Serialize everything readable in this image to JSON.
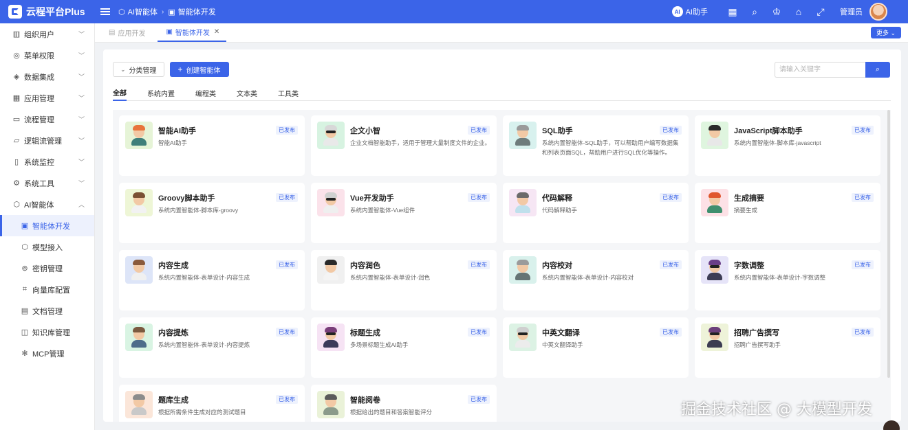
{
  "brand": {
    "title": "云程平台Plus"
  },
  "breadcrumb": [
    {
      "icon": "ai-cube-icon",
      "label": "AI智能体"
    },
    {
      "icon": "agent-dev-icon",
      "label": "智能体开发"
    }
  ],
  "header": {
    "ai_assistant": "AI助手",
    "ai_badge": "AI",
    "admin": "管理员"
  },
  "sidebar": {
    "items": [
      {
        "label": "组织用户",
        "icon": "org-icon"
      },
      {
        "label": "菜单权限",
        "icon": "menu-perm-icon"
      },
      {
        "label": "数据集成",
        "icon": "data-integration-icon"
      },
      {
        "label": "应用管理",
        "icon": "app-grid-icon"
      },
      {
        "label": "流程管理",
        "icon": "process-icon"
      },
      {
        "label": "逻辑流管理",
        "icon": "logic-flow-icon"
      },
      {
        "label": "系统监控",
        "icon": "monitor-icon"
      },
      {
        "label": "系统工具",
        "icon": "tool-gear-icon"
      },
      {
        "label": "AI智能体",
        "icon": "ai-cube-icon"
      }
    ],
    "sub_items": [
      {
        "label": "智能体开发",
        "icon": "agent-dev-icon",
        "active": true
      },
      {
        "label": "模型接入",
        "icon": "model-cube-icon"
      },
      {
        "label": "密钥管理",
        "icon": "key-icon"
      },
      {
        "label": "向量库配置",
        "icon": "vector-crop-icon"
      },
      {
        "label": "文档管理",
        "icon": "document-icon"
      },
      {
        "label": "知识库管理",
        "icon": "book-icon"
      },
      {
        "label": "MCP管理",
        "icon": "mcp-gear-icon"
      }
    ]
  },
  "tabs": [
    {
      "label": "应用开发",
      "active": false
    },
    {
      "label": "智能体开发",
      "active": true
    }
  ],
  "more_label": "更多",
  "toolbar": {
    "category_btn": "分类管理",
    "create_btn": "创建智能体"
  },
  "search": {
    "placeholder": "请输入关键字"
  },
  "categories": [
    "全部",
    "系统内置",
    "编程类",
    "文本类",
    "工具类"
  ],
  "status_label": "已发布",
  "agents": [
    {
      "title": "智能AI助手",
      "desc": "智能AI助手",
      "bg": "#e6f4d7",
      "hair": "#e8743b",
      "shirt": "#3f7f7a",
      "glasses": false
    },
    {
      "title": "企文小智",
      "desc": "企业文档智能助手，适用于管理大量制度文件的企业。",
      "bg": "#d7f3e1",
      "hair": "#d8d8d8",
      "shirt": "#e9e9e9",
      "glasses": true
    },
    {
      "title": "SQL助手",
      "desc": "系统内置智能体-SQL助手，可以帮助用户编写数据集和列表页面SQL，帮助用户进行SQL优化等操作。",
      "bg": "#d8f1ee",
      "hair": "#9a9a9a",
      "shirt": "#6e7c7c",
      "glasses": false
    },
    {
      "title": "JavaScript脚本助手",
      "desc": "系统内置智能体-脚本库-javascript",
      "bg": "#dff5df",
      "hair": "#2b2b2b",
      "shirt": "#e8e8e8",
      "glasses": false
    },
    {
      "title": "Groovy脚本助手",
      "desc": "系统内置智能体-脚本库-groovy",
      "bg": "#eef6d6",
      "hair": "#7a5034",
      "shirt": "#f2f2f2",
      "glasses": false
    },
    {
      "title": "Vue开发助手",
      "desc": "系统内置智能体-Vue组件",
      "bg": "#fbe2ea",
      "hair": "#d0d0d0",
      "shirt": "#efefef",
      "glasses": true
    },
    {
      "title": "代码解释",
      "desc": "代码解释助手",
      "bg": "#f6e6f4",
      "hair": "#6a6a6a",
      "shirt": "#bfe0ec",
      "glasses": false
    },
    {
      "title": "生成摘要",
      "desc": "摘要生成",
      "bg": "#fde1e6",
      "hair": "#e0572e",
      "shirt": "#3f8f6e",
      "glasses": false
    },
    {
      "title": "内容生成",
      "desc": "系统内置智能体-表单设计-内容生成",
      "bg": "#dde5f8",
      "hair": "#8a5a3c",
      "shirt": "#f0f0f0",
      "glasses": false
    },
    {
      "title": "内容润色",
      "desc": "系统内置智能体-表单设计-润色",
      "bg": "#f0f0f0",
      "hair": "#2a2a2a",
      "shirt": "#f4f4f4",
      "glasses": false
    },
    {
      "title": "内容校对",
      "desc": "系统内置智能体-表单设计-内容校对",
      "bg": "#d9f1ec",
      "hair": "#9b9b9b",
      "shirt": "#657575",
      "glasses": false
    },
    {
      "title": "字数调整",
      "desc": "系统内置智能体-表单设计-字数调整",
      "bg": "#e6e4f8",
      "hair": "#6a3f88",
      "shirt": "#3d3d55",
      "glasses": true
    },
    {
      "title": "内容提炼",
      "desc": "系统内置智能体-表单设计-内容提炼",
      "bg": "#d9f4e3",
      "hair": "#7b5a40",
      "shirt": "#4e6c8a",
      "glasses": false
    },
    {
      "title": "标题生成",
      "desc": "多场景标题生成AI助手",
      "bg": "#f6e3f4",
      "hair": "#7a3e7a",
      "shirt": "#3b3b5a",
      "glasses": true
    },
    {
      "title": "中英文翻译",
      "desc": "中英文翻译助手",
      "bg": "#dcf2e4",
      "hair": "#cfcfcf",
      "shirt": "#ececec",
      "glasses": true
    },
    {
      "title": "招聘广告撰写",
      "desc": "招聘广告撰写助手",
      "bg": "#eef3d9",
      "hair": "#6b3f7a",
      "shirt": "#3c3c52",
      "glasses": true
    },
    {
      "title": "题库生成",
      "desc": "根据所需条件生成对应的测试题目",
      "bg": "#fbe6d9",
      "hair": "#8c8c8c",
      "shirt": "#c9c9c9",
      "glasses": false
    },
    {
      "title": "智能阅卷",
      "desc": "根据给出的题目和答案智能评分",
      "bg": "#eaf2d8",
      "hair": "#5b5b5b",
      "shirt": "#8b9b8b",
      "glasses": false
    }
  ],
  "watermark": "掘金技术社区 @ 大模型开发"
}
